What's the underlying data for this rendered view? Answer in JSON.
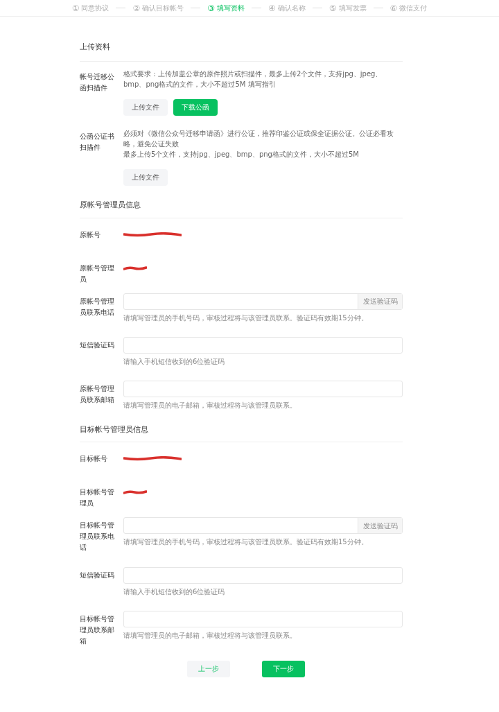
{
  "steps": [
    {
      "number": "①",
      "label": "同意协议",
      "selected": false
    },
    {
      "number": "②",
      "label": "确认目标帐号",
      "selected": false
    },
    {
      "number": "③",
      "label": "填写资料",
      "selected": true
    },
    {
      "number": "④",
      "label": "确认名称",
      "selected": false
    },
    {
      "number": "⑤",
      "label": "填写发票",
      "selected": false
    },
    {
      "number": "⑥",
      "label": "微信支付",
      "selected": false
    }
  ],
  "upload": {
    "title": "上传资料",
    "items": [
      {
        "label": "帐号迁移公函扫描件",
        "notes": [
          "格式要求：上传加盖公章的原件照片或扫描件，最多上传2个文件，支持jpg、jpeg、bmp、png格式的文件，大小不超过5M 填写指引"
        ],
        "buttons": [
          {
            "label": "上传文件",
            "primary": false
          },
          {
            "label": "下载公函",
            "primary": true
          }
        ]
      },
      {
        "label": "公函公证书扫描件",
        "notes": [
          "必须对《微信公众号迁移申请函》进行公证，推荐印鉴公证或保全证据公证。公证必看攻略，避免公证失败",
          "最多上传5个文件，支持jpg、jpeg、bmp、png格式的文件，大小不超过5M"
        ],
        "buttons": [
          {
            "label": "上传文件",
            "primary": false
          }
        ]
      }
    ]
  },
  "sections": [
    {
      "title": "原帐号管理员信息",
      "fields": [
        {
          "kind": "redacted",
          "label": "原帐号"
        },
        {
          "kind": "redacted",
          "label": "原帐号管理员"
        },
        {
          "kind": "phone",
          "label": "原帐号管理员联系电话",
          "button": "发送验证码",
          "hint": "请填写管理员的手机号码，审核过程将与该管理员联系。验证码有效期15分钟。"
        },
        {
          "kind": "input",
          "label": "短信验证码",
          "hint": "请输入手机短信收到的6位验证码"
        },
        {
          "kind": "input",
          "label": "原帐号管理员联系邮箱",
          "hint": "请填写管理员的电子邮箱，审核过程将与该管理员联系。"
        }
      ]
    },
    {
      "title": "目标帐号管理员信息",
      "fields": [
        {
          "kind": "redacted",
          "label": "目标帐号"
        },
        {
          "kind": "redacted",
          "label": "目标帐号管理员"
        },
        {
          "kind": "phone",
          "label": "目标帐号管理员联系电话",
          "button": "发送验证码",
          "hint": "请填写管理员的手机号码，审核过程将与该管理员联系。验证码有效期15分钟。"
        },
        {
          "kind": "input",
          "label": "短信验证码",
          "hint": "请输入手机短信收到的6位验证码"
        },
        {
          "kind": "input",
          "label": "目标帐号管理员联系邮箱",
          "hint": "请填写管理员的电子邮箱，审核过程将与该管理员联系。"
        }
      ]
    }
  ],
  "footer": {
    "prev": "上一步",
    "next": "下一步"
  }
}
